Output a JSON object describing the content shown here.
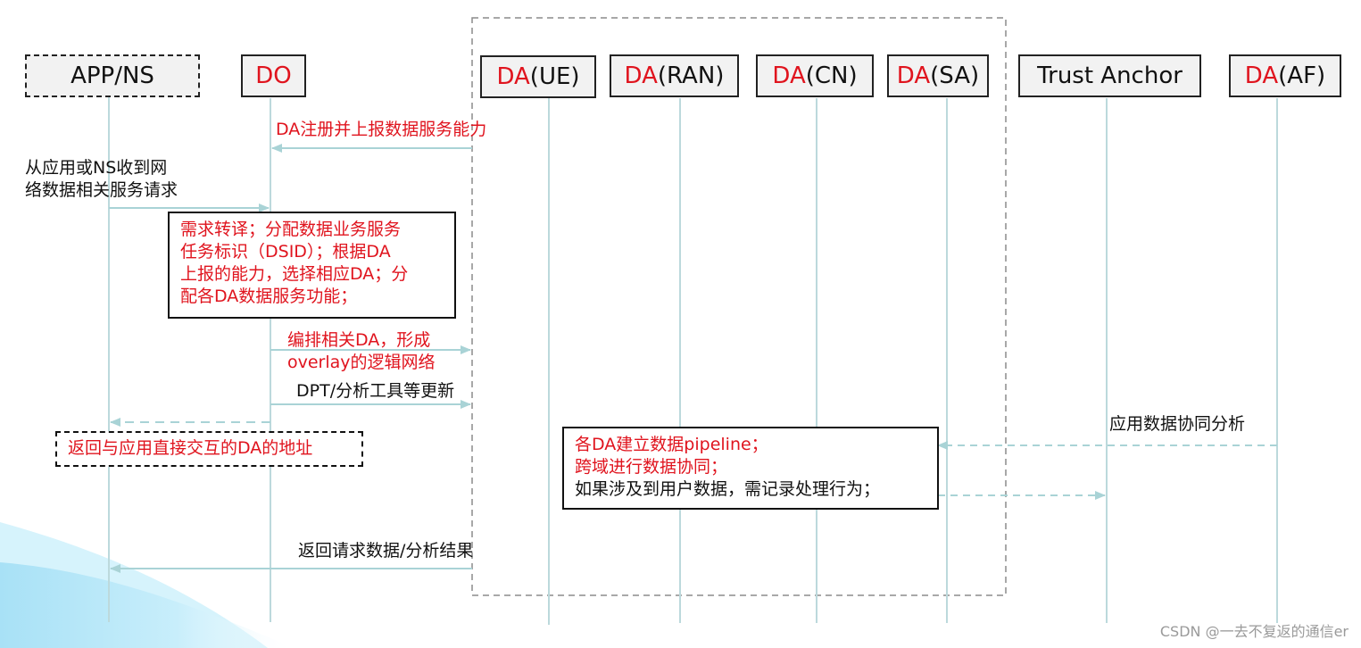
{
  "colors": {
    "accent_red": "#e0141e",
    "lifeline": "#bcd9dc",
    "arrow": "#a9d3d6",
    "frame_dash": "#8c8c8c",
    "actor_fill": "#f2f2f2",
    "wave": "#aee4f7"
  },
  "actors": [
    {
      "id": "app_ns",
      "prefix": "",
      "name": "APP/NS",
      "style": "dashed"
    },
    {
      "id": "do",
      "prefix": "DO",
      "name": "",
      "style": "solid"
    },
    {
      "id": "da_ue",
      "prefix": "DA",
      "name": "(UE)",
      "style": "solid"
    },
    {
      "id": "da_ran",
      "prefix": "DA",
      "name": "(RAN)",
      "style": "solid"
    },
    {
      "id": "da_cn",
      "prefix": "DA",
      "name": "(CN)",
      "style": "solid"
    },
    {
      "id": "da_sa",
      "prefix": "DA",
      "name": "(SA)",
      "style": "solid"
    },
    {
      "id": "trust_anchor",
      "prefix": "",
      "name": "Trust Anchor",
      "style": "solid"
    },
    {
      "id": "da_af",
      "prefix": "DA",
      "name": "(AF)",
      "style": "solid"
    }
  ],
  "group_frame": {
    "label": "",
    "members": [
      "da_ue",
      "da_ran",
      "da_cn",
      "da_sa"
    ]
  },
  "messages": [
    {
      "id": "m1",
      "from": "da_group",
      "to": "do",
      "text": "DA注册并上报数据服务能力",
      "color": "red",
      "style": "solid"
    },
    {
      "id": "m2",
      "from": "app_ns",
      "to": "do",
      "text_lines": [
        "从应用或NS收到网",
        "络数据相关服务请求"
      ],
      "color": "black",
      "style": "solid"
    },
    {
      "id": "m3",
      "from": "do",
      "to": "da_group",
      "text_lines": [
        "编排相关DA，形成",
        "overlay的逻辑网络"
      ],
      "color": "red",
      "style": "solid"
    },
    {
      "id": "m4",
      "from": "do",
      "to": "da_group",
      "text": "DPT/分析工具等更新",
      "color": "black",
      "style": "solid"
    },
    {
      "id": "m5",
      "from": "do",
      "to": "app_ns",
      "text": "",
      "color": "black",
      "style": "dashed"
    },
    {
      "id": "m6",
      "from": "da_af",
      "to": "da_sa",
      "text": "应用数据协同分析",
      "color": "black",
      "style": "dashed"
    },
    {
      "id": "m7",
      "from": "note2",
      "to": "trust_anchor",
      "text": "",
      "color": "black",
      "style": "dashed"
    },
    {
      "id": "m8",
      "from": "da_group",
      "to": "app_ns",
      "text": "返回请求数据/分析结果",
      "color": "black",
      "style": "solid"
    }
  ],
  "notes": {
    "do_processing": {
      "lines": [
        "需求转译；分配数据业务服务",
        "任务标识（DSID）；根据DA",
        "上报的能力，选择相应DA；分",
        "配各DA数据服务功能；"
      ]
    },
    "return_da_address": {
      "text": "返回与应用直接交互的DA的地址"
    },
    "pipeline": {
      "red_lines": [
        "各DA建立数据pipeline；",
        "跨域进行数据协同；"
      ],
      "black_lines": [
        "如果涉及到用户数据，需记录处理行为；"
      ]
    }
  },
  "watermark": "CSDN @一去不复返的通信er"
}
